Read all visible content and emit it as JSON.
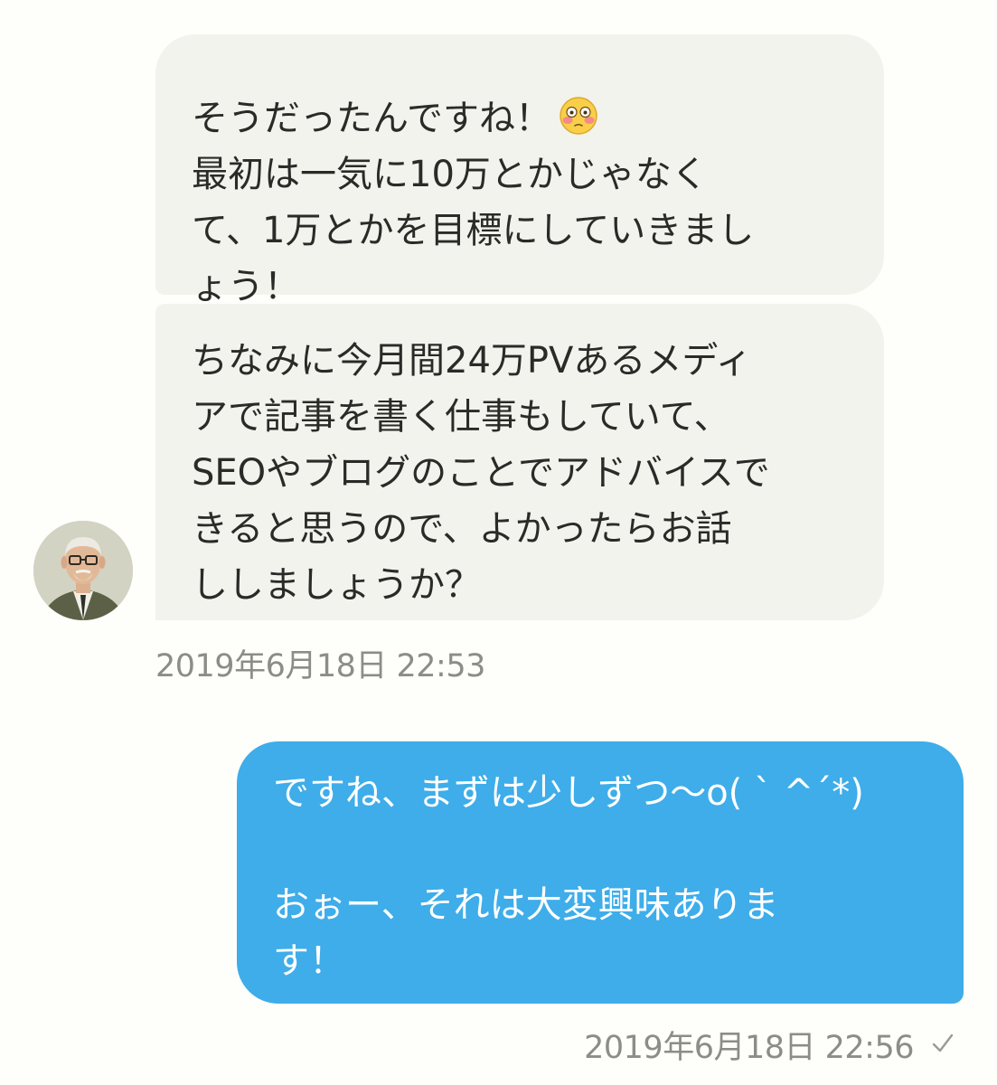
{
  "conversation": {
    "incoming": {
      "message_1": "そうだったんですね！",
      "message_1_emoji": "flushed-face-emoji",
      "message_1_cont": "最初は一気に10万とかじゃなく\nて、1万とかを目標にしていきまし\nょう！",
      "message_2": "ちなみに今月間24万PVあるメディ\nアで記事を書く仕事もしていて、\nSEOやブログのことでアドバイスで\nきると思うので、よかったらお話\nししましょうか？",
      "timestamp": "2019年6月18日 22:53",
      "avatar_icon": "elderly-man-portrait"
    },
    "outgoing": {
      "message": "ですね、まずは少しずつ〜o( ˋ ^ˊ*)\n\nおぉー、それは大変興味ありま\nす！",
      "timestamp": "2019年6月18日 22:56",
      "status_icon": "check-icon"
    }
  },
  "colors": {
    "incoming_bubble": "#f2f3ec",
    "outgoing_bubble": "#3eadea",
    "timestamp_text": "#8c8c88",
    "background": "#fefefb"
  }
}
